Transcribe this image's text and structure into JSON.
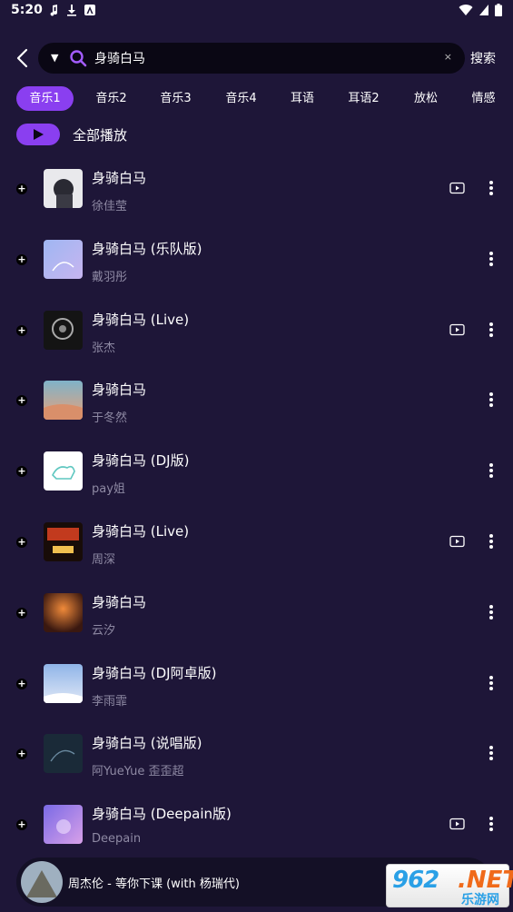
{
  "status_bar": {
    "time": "5:20"
  },
  "search": {
    "query": "身骑白马",
    "search_button": "搜索",
    "dropdown_glyph": "▼",
    "clear_glyph": "×"
  },
  "tabs": [
    "音乐1",
    "音乐2",
    "音乐3",
    "音乐4",
    "耳语",
    "耳语2",
    "放松",
    "情感"
  ],
  "active_tab": "音乐1",
  "play_all_label": "全部播放",
  "songs": [
    {
      "title": "身骑白马",
      "artist": "徐佳莹",
      "has_mv": true
    },
    {
      "title": "身骑白马 (乐队版)",
      "artist": "戴羽彤",
      "has_mv": false
    },
    {
      "title": "身骑白马 (Live)",
      "artist": "张杰",
      "has_mv": true
    },
    {
      "title": "身骑白马",
      "artist": "于冬然",
      "has_mv": false
    },
    {
      "title": "身骑白马 (DJ版)",
      "artist": "pay姐",
      "has_mv": false
    },
    {
      "title": "身骑白马 (Live)",
      "artist": "周深",
      "has_mv": true
    },
    {
      "title": "身骑白马",
      "artist": "云汐",
      "has_mv": false
    },
    {
      "title": "身骑白马 (DJ阿卓版)",
      "artist": "李雨霏",
      "has_mv": false
    },
    {
      "title": "身骑白马 (说唱版)",
      "artist": "阿YueYue 歪歪超",
      "has_mv": false
    },
    {
      "title": "身骑白马 (Deepain版)",
      "artist": "Deepain",
      "has_mv": true
    }
  ],
  "now_playing": "周杰伦 - 等你下课 (with 杨瑞代)",
  "watermark": {
    "main": "962",
    "dot": ".NET",
    "sub": "乐游网"
  },
  "colors": {
    "background": "#1e1638",
    "accent": "#8a3ff0",
    "search_bg": "#0a0714",
    "artist_text": "#8e89a3"
  }
}
